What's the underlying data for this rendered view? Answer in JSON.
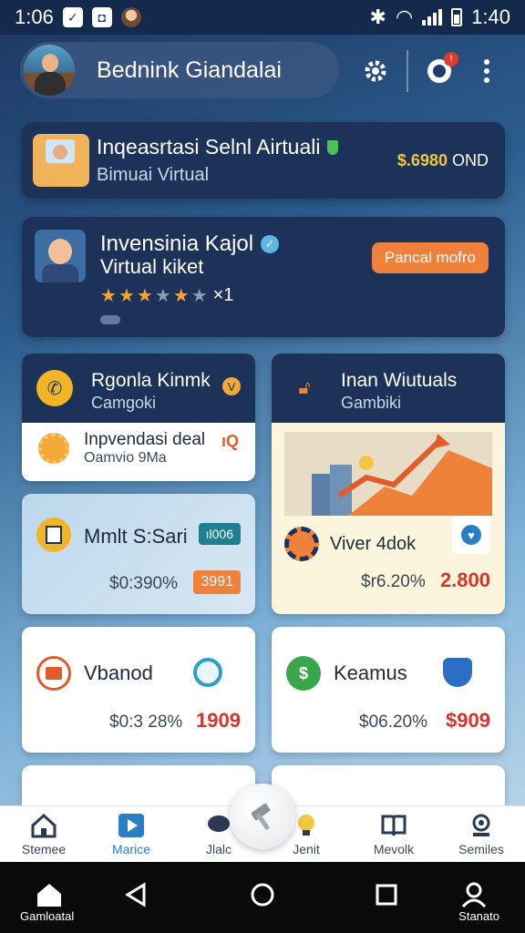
{
  "status_bar": {
    "time_left": "1:06",
    "time_right": "1:40"
  },
  "header": {
    "title": "Bednink Giandalai"
  },
  "banner_investasi": {
    "title": "Inqeasrtasi Selnl Airtuali",
    "subtitle": "Bimuai Virtual",
    "price": "$.6980",
    "currency": "OND"
  },
  "banner_kapal": {
    "title": "Invensinia Kajol",
    "subtitle": "Virtual kiket",
    "rating_text": "×1",
    "button_label": "Pancal mofro"
  },
  "tile_kinmk": {
    "title": "Rgonla Kinmk",
    "subtitle": "Camgoki",
    "row_title": "Inpvendasi deal",
    "row_subtitle": "Oamvio 9Ma",
    "mark": "V",
    "row_mark": "ıQ"
  },
  "tile_wiutuals": {
    "title": "Inan Wiutuals",
    "subtitle": "Gambiki",
    "name": "Viver 4dok",
    "percent": "$r6.20%",
    "value": "2.800"
  },
  "tile_mmlt": {
    "name": "Mmlt S:Sari",
    "badge": "ıl006",
    "percent": "$0:390%",
    "value": "3991"
  },
  "tile_vbanod": {
    "name": "Vbanod",
    "percent": "$0:3 28%",
    "value": "1909",
    "value_color": "#d8342a"
  },
  "tile_keamus": {
    "name": "Keamus",
    "percent": "$06.20%",
    "value": "$909",
    "value_color": "#d8342a"
  },
  "bottom_nav": [
    {
      "label": "Stemee",
      "icon": "home-icon"
    },
    {
      "label": "Marice",
      "icon": "play-icon",
      "active": true
    },
    {
      "label": "Jlalc",
      "icon": "chat-icon"
    },
    {
      "label": "Jenit",
      "icon": "bulb-icon"
    },
    {
      "label": "Mevolk",
      "icon": "book-icon"
    },
    {
      "label": "Semiles",
      "icon": "profile-icon"
    }
  ],
  "system_nav": {
    "home_label": "Gamloatal",
    "profile_label": "Stanato"
  },
  "colors": {
    "accent": "#f0813a",
    "navy": "#1d3258",
    "gold": "#f2c542",
    "red": "#d8342a"
  }
}
